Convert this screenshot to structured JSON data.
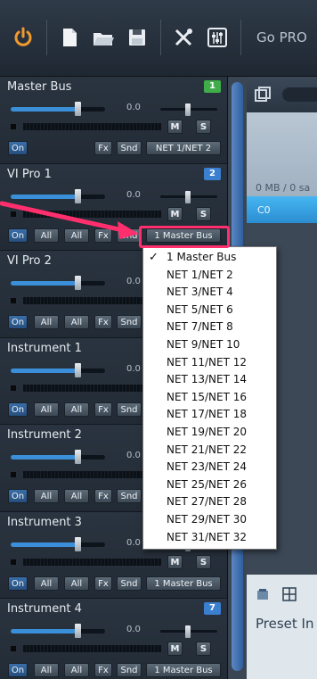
{
  "toolbar": {
    "gopro_label": "Go PRO"
  },
  "channels": [
    {
      "name": "Master Bus",
      "num": "1",
      "num_color": "#3fae4a",
      "vol": "0.0",
      "on": "On",
      "fx": "Fx",
      "snd": "Snd",
      "out": "NET 1/NET 2",
      "m": "M",
      "s": "S"
    },
    {
      "name": "VI Pro 1",
      "num": "2",
      "num_color": "#3b7fd0",
      "vol": "0.0",
      "on": "On",
      "all1": "All",
      "all2": "All",
      "fx": "Fx",
      "snd": "Snd",
      "out": "1 Master Bus",
      "m": "M",
      "s": "S"
    },
    {
      "name": "VI Pro 2",
      "vol": "0.0",
      "on": "On",
      "all1": "All",
      "all2": "All",
      "fx": "Fx",
      "snd": "Snd"
    },
    {
      "name": "Instrument 1",
      "vol": "0.0",
      "on": "On",
      "all1": "All",
      "all2": "All",
      "fx": "Fx",
      "snd": "Snd"
    },
    {
      "name": "Instrument 2",
      "vol": "0.0",
      "on": "On",
      "all1": "All",
      "all2": "All",
      "fx": "Fx",
      "snd": "Snd"
    },
    {
      "name": "Instrument 3",
      "vol": "0.0",
      "on": "On",
      "all1": "All",
      "all2": "All",
      "fx": "Fx",
      "snd": "Snd",
      "out": "1 Master Bus",
      "m": "M",
      "s": "S"
    },
    {
      "name": "Instrument 4",
      "num": "7",
      "num_color": "#3b7fd0",
      "vol": "0.0",
      "on": "On",
      "all1": "All",
      "all2": "All",
      "fx": "Fx",
      "snd": "Snd",
      "out": "1 Master Bus",
      "m": "M",
      "s": "S"
    }
  ],
  "right": {
    "mb_text": "0 MB / 0 sa",
    "clip_label": "C0",
    "preset_label": "Preset In"
  },
  "menu": {
    "items": [
      "1 Master Bus",
      "NET 1/NET 2",
      "NET 3/NET 4",
      "NET 5/NET 6",
      "NET 7/NET 8",
      "NET 9/NET 10",
      "NET 11/NET 12",
      "NET 13/NET 14",
      "NET 15/NET 16",
      "NET 17/NET 18",
      "NET 19/NET 20",
      "NET 21/NET 22",
      "NET 23/NET 24",
      "NET 25/NET 26",
      "NET 27/NET 28",
      "NET 29/NET 30",
      "NET 31/NET 32"
    ],
    "checked_index": 0,
    "check_mark": "✓"
  },
  "colors": {
    "highlight": "#ff2f6e",
    "accent": "#3b8fd8"
  }
}
